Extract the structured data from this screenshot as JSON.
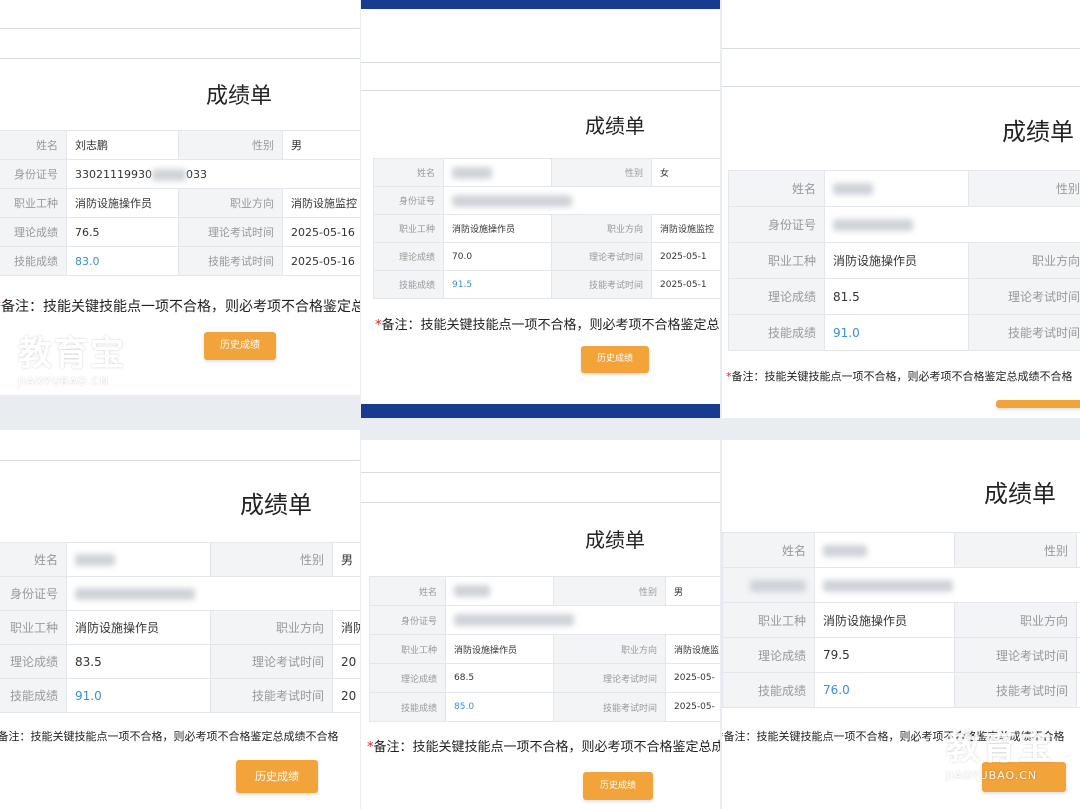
{
  "common": {
    "title": "成绩单",
    "note": "备注：技能关键技能点一项不合格，则必考项不合格鉴定总成绩不合格",
    "note_star": "*",
    "button": "历史成绩",
    "labels": {
      "name": "姓名",
      "gender": "性别",
      "id": "身份证号",
      "job": "职业工种",
      "direction": "职业方向",
      "theory": "理论成绩",
      "theory_time": "理论考试时间",
      "skill": "技能成绩",
      "skill_time": "技能考试时间"
    }
  },
  "panels": [
    {
      "name": "刘志鹏",
      "gender": "男",
      "id": "33021119930",
      "id_tail": "033",
      "job": "消防设施操作员",
      "direction": "消防设施监控",
      "theory": "76.5",
      "theory_time": "2025-05-16",
      "skill": "83.0",
      "skill_time": "2025-05-16"
    },
    {
      "name": "",
      "gender": "女",
      "id": "",
      "id_tail": "",
      "job": "消防设施操作员",
      "direction": "消防设施监控",
      "theory": "70.0",
      "theory_time": "2025-05-1",
      "skill": "91.5",
      "skill_time": "2025-05-1"
    },
    {
      "name": "",
      "gender": "",
      "id": "",
      "id_tail": "",
      "job": "消防设施操作员",
      "direction": "",
      "theory": "81.5",
      "theory_time": "",
      "skill": "91.0",
      "skill_time": ""
    },
    {
      "name": "",
      "gender": "男",
      "id": "",
      "id_tail": "",
      "job": "消防设施操作员",
      "direction": "消防",
      "theory": "83.5",
      "theory_time": "20",
      "skill": "91.0",
      "skill_time": "20"
    },
    {
      "name": "",
      "gender": "男",
      "id": "",
      "id_tail": "",
      "job": "消防设施操作员",
      "direction": "消防设施监",
      "theory": "68.5",
      "theory_time": "2025-05-",
      "skill": "85.0",
      "skill_time": "2025-05-"
    },
    {
      "name": "",
      "gender": "",
      "id": "",
      "id_tail": "",
      "job": "消防设施操作员",
      "direction": "",
      "theory": "79.5",
      "theory_time": "",
      "skill": "76.0",
      "skill_time": ""
    }
  ],
  "watermark": {
    "big": "教育宝",
    "small": "JIAOYUBAO.CN"
  },
  "colors": {
    "accent": "#f2a33a",
    "skill": "#3b8fd6",
    "band": "#173b8f",
    "star": "#e02020"
  }
}
